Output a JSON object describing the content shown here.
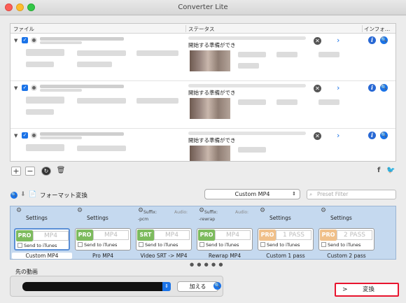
{
  "window": {
    "title": "Converter Lite"
  },
  "table": {
    "headers": [
      "ファイル",
      "ステータス",
      "インフォ…"
    ],
    "rows": [
      {
        "status": "開始する準備ができ"
      },
      {
        "status": "開始する準備ができ"
      },
      {
        "status": "開始する準備ができ"
      }
    ]
  },
  "toolbar": {
    "add": "+",
    "remove": "−",
    "social_f": "f"
  },
  "format": {
    "label": "フォーマット変換",
    "selected": "Custom MP4",
    "filter_placeholder": "Preset Filter"
  },
  "presets": [
    {
      "settings": "Settings",
      "badge": "PRO",
      "badge_color": "#7dbb5e",
      "format": "MP4",
      "itunes": "Send to iTunes",
      "name": "Custom MP4"
    },
    {
      "settings": "Settings",
      "badge": "PRO",
      "badge_color": "#7dbb5e",
      "format": "MP4",
      "itunes": "Send to iTunes",
      "name": "Pro MP4"
    },
    {
      "suffix": "Suffix:",
      "audio": "Audio:",
      "suffix_val": "-pcm",
      "badge": "SRT",
      "badge_color": "#7dbb5e",
      "format": "MP4",
      "itunes": "Send to iTunes",
      "name": "Video SRT -> MP4"
    },
    {
      "suffix": "Suffix:",
      "audio": "Audio:",
      "suffix_val": "-rewrap",
      "badge": "PRO",
      "badge_color": "#7dbb5e",
      "format": "MP4",
      "itunes": "Send to iTunes",
      "name": "Rewrap MP4"
    },
    {
      "settings": "Settings",
      "badge": "PRO",
      "badge_color": "#f0c08a",
      "format": "1 PASS",
      "itunes": "Send to iTunes",
      "name": "Custom 1 pass"
    },
    {
      "settings": "Settings",
      "badge": "PRO",
      "badge_color": "#f0c08a",
      "format": "2 PASS",
      "itunes": "Send to iTunes",
      "name": "Custom 2 pass"
    }
  ],
  "dots": "● ● ● ● ●",
  "preview": {
    "label": "先の動画",
    "add_button": "加える"
  },
  "convert": {
    "arrow": ">",
    "label": "変換"
  }
}
